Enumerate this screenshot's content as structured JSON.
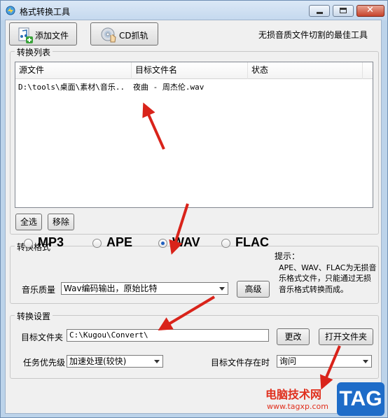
{
  "window": {
    "title": "格式转换工具"
  },
  "toolbar": {
    "add_file_label": "添加文件",
    "cd_rip_label": "CD抓轨",
    "slogan": "无损音质文件切割的最佳工具"
  },
  "convert_list": {
    "group_title": "转换列表",
    "columns": [
      "源文件",
      "目标文件名",
      "状态"
    ],
    "rows": [
      {
        "source": "D:\\tools\\桌面\\素材\\音乐..",
        "target": "夜曲 - 周杰伦.wav",
        "status": ""
      }
    ],
    "select_all_label": "全选",
    "remove_label": "移除"
  },
  "format": {
    "group_title": "转换格式",
    "options": [
      "MP3",
      "APE",
      "WAV",
      "FLAC"
    ],
    "selected": "WAV",
    "quality_label": "音乐质量",
    "quality_value": "Wav编码输出，原始比特",
    "advanced_label": "高级",
    "hint_title": "提示：",
    "hint_body": "APE、WAV、FLAC为无损音乐格式文件，只能通过无损音乐格式转换而成。"
  },
  "settings": {
    "group_title": "转换设置",
    "target_folder_label": "目标文件夹",
    "target_folder_value": "C:\\Kugou\\Convert\\",
    "change_label": "更改",
    "open_folder_label": "打开文件夹",
    "priority_label": "任务优先级",
    "priority_value": "加速处理(较快)",
    "exists_label": "目标文件存在时",
    "exists_value": "询问"
  },
  "watermark": {
    "site_name": "电脑技术网",
    "site_url": "www.tagxp.com",
    "tag": "TAG"
  },
  "colors": {
    "annotation_arrow": "#d9231a",
    "selected_radio": "#1f5fbf"
  }
}
